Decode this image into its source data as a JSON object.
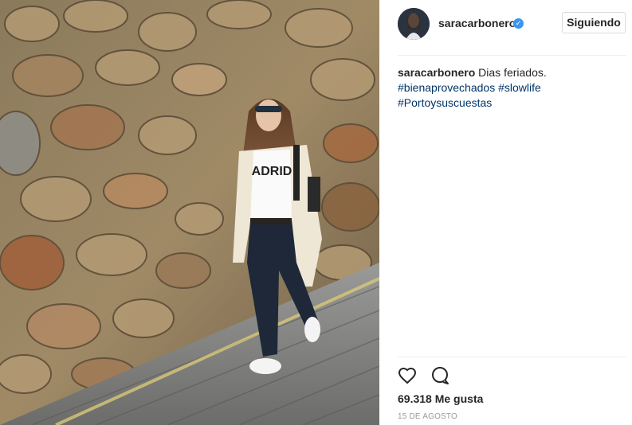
{
  "post": {
    "username": "saracarbonero",
    "verified_icon": "verified-badge-icon",
    "follow_label": "Siguiendo",
    "caption": {
      "user": "saracarbonero",
      "text": "Dias feriados.",
      "tags": [
        "#bienaprovechados",
        "#slowlife",
        "#Portoysuscuestas"
      ]
    },
    "likes": "69.318 Me gusta",
    "date": "15 DE AGOSTO",
    "actions": [
      "heart-icon",
      "comment-icon"
    ],
    "shirt_text": "ADRID"
  },
  "colors": {
    "link": "#003569",
    "verified": "#3897f0",
    "muted": "#999999",
    "border": "#dbdbdb"
  }
}
